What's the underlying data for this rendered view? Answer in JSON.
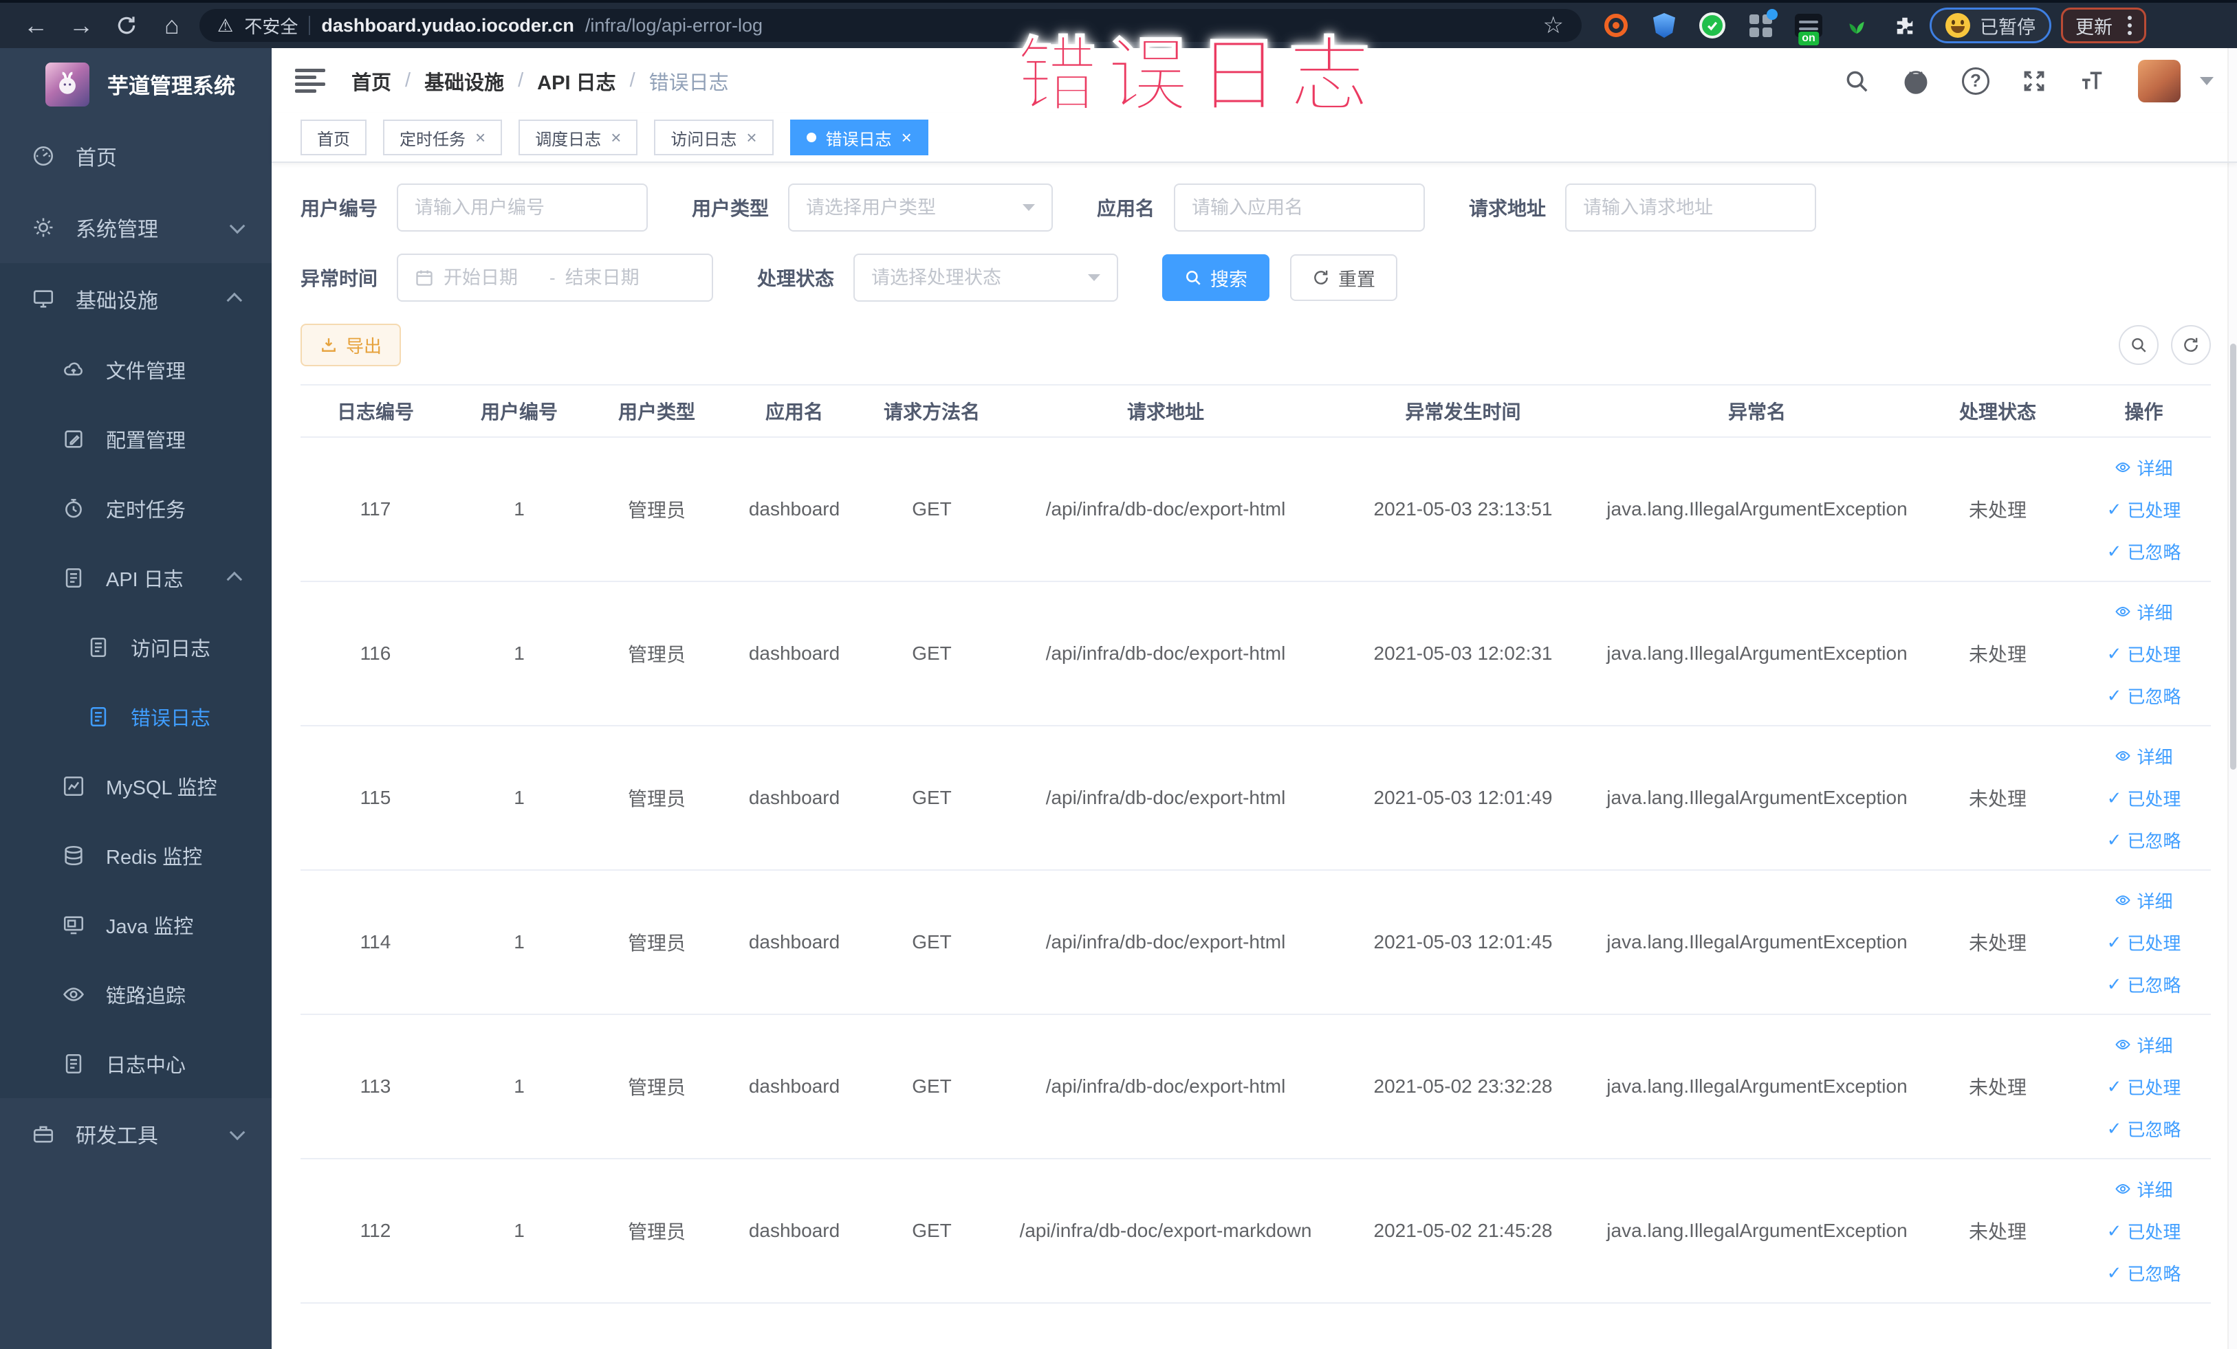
{
  "colors": {
    "primary": "#409eff",
    "warning": "#e6a23c",
    "sidebar_bg": "#304156",
    "sidebar_sub_bg": "#293b4f",
    "annotation": "#eb3b62",
    "browser_bar": "#202b3a"
  },
  "icons": {
    "back": "←",
    "forward": "→",
    "home": "⌂",
    "star": "☆",
    "warning": "⚠",
    "question": "?",
    "check": "✓"
  },
  "annotation": {
    "text": "错误日志"
  },
  "browser": {
    "security": "不安全",
    "url_domain": "dashboard.yudao.iocoder.cn",
    "url_path": "/infra/log/api-error-log",
    "ext_on_badge": "on",
    "paused": "已暂停",
    "update": "更新"
  },
  "sidebar": {
    "title": "芋道管理系统",
    "items": [
      {
        "label": "首页"
      },
      {
        "label": "系统管理"
      },
      {
        "label": "基础设施"
      },
      {
        "label": "文件管理"
      },
      {
        "label": "配置管理"
      },
      {
        "label": "定时任务"
      },
      {
        "label": "API 日志"
      },
      {
        "label": "访问日志"
      },
      {
        "label": "错误日志"
      },
      {
        "label": "MySQL 监控"
      },
      {
        "label": "Redis 监控"
      },
      {
        "label": "Java 监控"
      },
      {
        "label": "链路追踪"
      },
      {
        "label": "日志中心"
      },
      {
        "label": "研发工具"
      }
    ]
  },
  "breadcrumb": {
    "separator": "/",
    "items": [
      {
        "label": "首页"
      },
      {
        "label": "基础设施"
      },
      {
        "label": "API 日志"
      },
      {
        "label": "错误日志"
      }
    ]
  },
  "tags": {
    "close_glyph": "×",
    "items": [
      {
        "label": "首页"
      },
      {
        "label": "定时任务"
      },
      {
        "label": "调度日志"
      },
      {
        "label": "访问日志"
      },
      {
        "label": "错误日志"
      }
    ]
  },
  "filters": {
    "user_id": {
      "label": "用户编号",
      "placeholder": "请输入用户编号"
    },
    "user_type": {
      "label": "用户类型",
      "placeholder": "请选择用户类型"
    },
    "app_name": {
      "label": "应用名",
      "placeholder": "请输入应用名"
    },
    "request_url": {
      "label": "请求地址",
      "placeholder": "请输入请求地址"
    },
    "exception_time": {
      "label": "异常时间",
      "start": "开始日期",
      "separator": "-",
      "end": "结束日期"
    },
    "process_status": {
      "label": "处理状态",
      "placeholder": "请选择处理状态"
    },
    "search": "搜索",
    "reset": "重置"
  },
  "toolbar": {
    "export": "导出"
  },
  "table": {
    "columns": [
      "日志编号",
      "用户编号",
      "用户类型",
      "应用名",
      "请求方法名",
      "请求地址",
      "异常发生时间",
      "异常名",
      "处理状态",
      "操作"
    ],
    "row_actions": {
      "detail": "详细",
      "processed": "已处理",
      "ignored": "已忽略"
    },
    "rows": [
      {
        "id": "117",
        "user_id": "1",
        "user_type": "管理员",
        "app": "dashboard",
        "method": "GET",
        "url": "/api/infra/db-doc/export-html",
        "time": "2021-05-03 23:13:51",
        "exception": "java.lang.IllegalArgumentException",
        "status": "未处理"
      },
      {
        "id": "116",
        "user_id": "1",
        "user_type": "管理员",
        "app": "dashboard",
        "method": "GET",
        "url": "/api/infra/db-doc/export-html",
        "time": "2021-05-03 12:02:31",
        "exception": "java.lang.IllegalArgumentException",
        "status": "未处理"
      },
      {
        "id": "115",
        "user_id": "1",
        "user_type": "管理员",
        "app": "dashboard",
        "method": "GET",
        "url": "/api/infra/db-doc/export-html",
        "time": "2021-05-03 12:01:49",
        "exception": "java.lang.IllegalArgumentException",
        "status": "未处理"
      },
      {
        "id": "114",
        "user_id": "1",
        "user_type": "管理员",
        "app": "dashboard",
        "method": "GET",
        "url": "/api/infra/db-doc/export-html",
        "time": "2021-05-03 12:01:45",
        "exception": "java.lang.IllegalArgumentException",
        "status": "未处理"
      },
      {
        "id": "113",
        "user_id": "1",
        "user_type": "管理员",
        "app": "dashboard",
        "method": "GET",
        "url": "/api/infra/db-doc/export-html",
        "time": "2021-05-02 23:32:28",
        "exception": "java.lang.IllegalArgumentException",
        "status": "未处理"
      },
      {
        "id": "112",
        "user_id": "1",
        "user_type": "管理员",
        "app": "dashboard",
        "method": "GET",
        "url": "/api/infra/db-doc/export-markdown",
        "time": "2021-05-02 21:45:28",
        "exception": "java.lang.IllegalArgumentException",
        "status": "未处理"
      }
    ]
  }
}
